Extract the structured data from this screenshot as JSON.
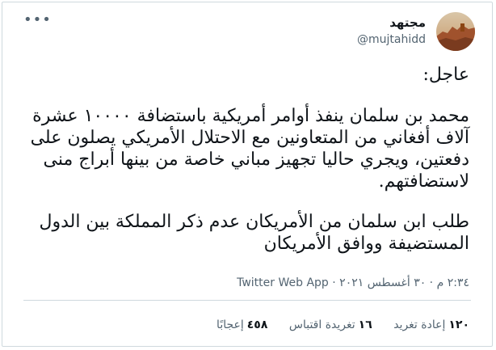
{
  "tweet": {
    "author": {
      "display_name": "مجتهد",
      "handle": "@mujtahidd"
    },
    "more_icon": "more-horizontal-icon",
    "text": {
      "heading": "عاجل:",
      "paragraph1": "محمد بن سلمان ينفذ أوامر أمريكية باستضافة ١٠٠٠٠ عشرة آلاف أفغاني من المتعاونين مع الاحتلال الأمريكي يصلون على دفعتين، ويجري حاليا تجهيز مباني خاصة من بينها أبراج منى لاستضافتهم.",
      "paragraph2": "طلب ابن سلمان من الأمريكان عدم ذكر المملكة بين الدول المستضيفة ووافق الأمريكان"
    },
    "meta": {
      "time": "٢:٣٤ م",
      "separator": " · ",
      "date": "٣٠ أغسطس ٢٠٢١",
      "app": "Twitter Web App"
    },
    "stats": {
      "retweets_count": "١٢٠",
      "retweets_label": "إعادة تغريد",
      "quotes_count": "١٦",
      "quotes_label": "تغريدة اقتباس",
      "likes_count": "٤٥٨",
      "likes_label": "إعجابًا"
    }
  },
  "colors": {
    "text_primary": "#0f1419",
    "text_secondary": "#536471",
    "border": "#cfd9de"
  }
}
